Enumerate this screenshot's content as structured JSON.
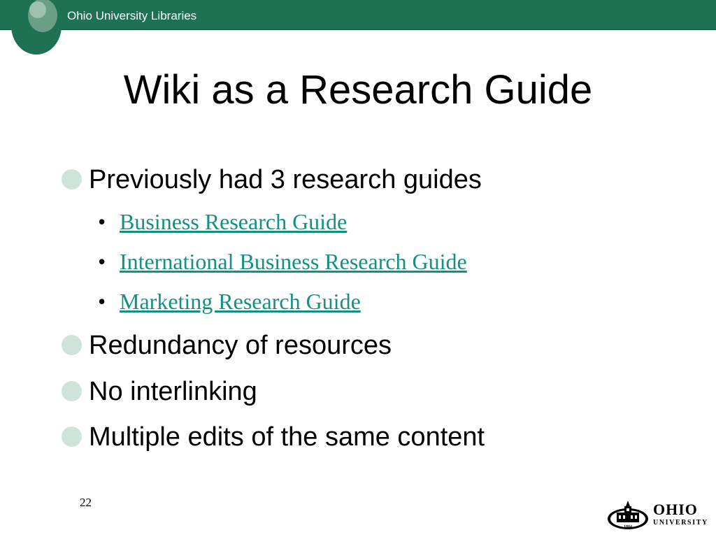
{
  "header": {
    "org_title": "Ohio University Libraries"
  },
  "slide": {
    "title": "Wiki as a Research Guide",
    "bullets": [
      {
        "text": "Previously had 3 research guides"
      },
      {
        "text": "Redundancy of resources"
      },
      {
        "text": "No interlinking"
      },
      {
        "text": "Multiple edits of the same content"
      }
    ],
    "sub_bullets": [
      {
        "text": "Business Research Guide"
      },
      {
        "text": "International Business Research Guide"
      },
      {
        "text": "Marketing Research Guide"
      }
    ],
    "sub_bullet_marker": "•",
    "page_number": "22"
  },
  "footer_logo": {
    "word_1": "OHIO",
    "word_2": "UNIVERSITY",
    "seal_year": "1804"
  },
  "colors": {
    "header_green": "#1e7152",
    "bullet_dot": "#cfe3da",
    "link": "#149082"
  }
}
